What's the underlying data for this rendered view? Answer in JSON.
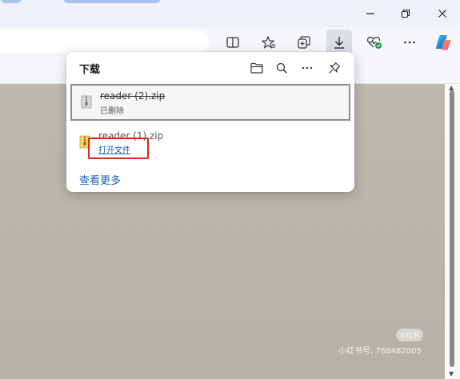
{
  "browser": {
    "window_controls": {
      "minimize": "minimize-icon",
      "restore": "restore-icon",
      "close": "close-icon"
    },
    "toolbar_icons": [
      "split-screen-icon",
      "favorites-icon",
      "collections-icon",
      "download-icon",
      "browser-essentials-icon",
      "more-icon",
      "copilot-icon"
    ]
  },
  "downloads": {
    "title": "下载",
    "tools": [
      "open-folder-icon",
      "search-icon",
      "more-icon",
      "pin-icon"
    ],
    "items": [
      {
        "name": "reader (2).zip",
        "status": "已删除"
      },
      {
        "name": "reader (1).zip",
        "action": "打开文件"
      }
    ],
    "see_more": "查看更多"
  },
  "watermark": {
    "badge": "小红书",
    "text": "小红书号: 768482005"
  },
  "colors": {
    "accent": "#1a5fb4",
    "highlight": "#e0251b",
    "content_bg": "#b8b5aa"
  }
}
